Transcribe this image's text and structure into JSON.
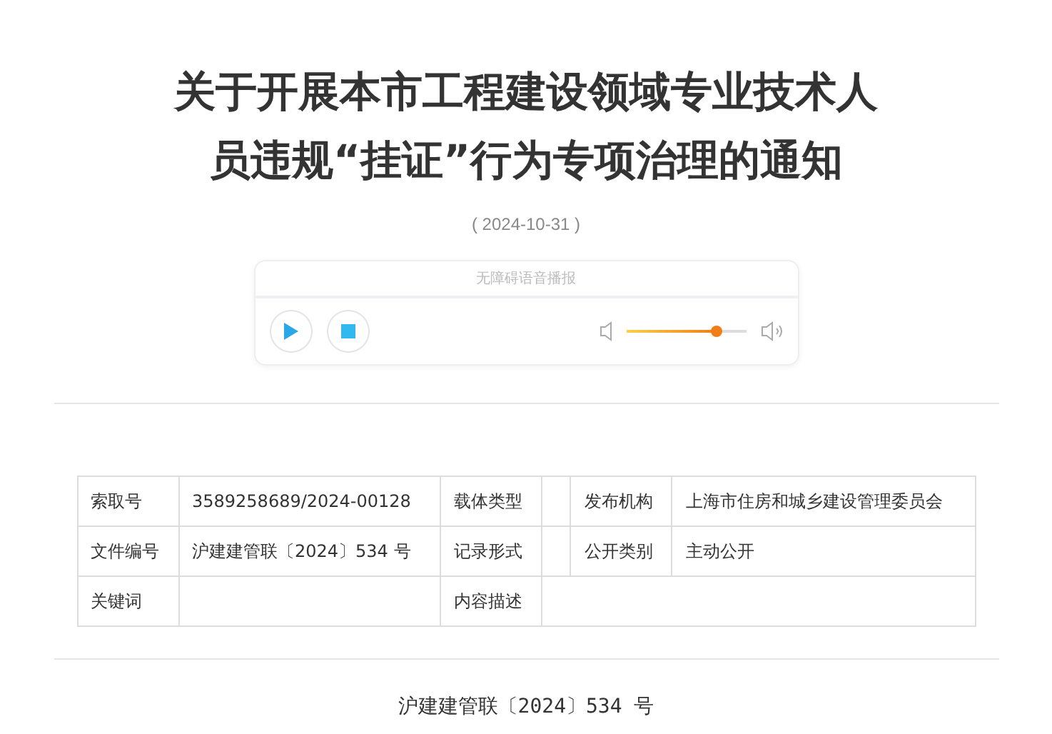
{
  "title_lines": [
    "关于开展本市工程建设领域专业技术人",
    "员违规“挂证”行为专项治理的通知"
  ],
  "date": "( 2024-10-31 )",
  "player": {
    "label": "无障碍语音播报",
    "volume": {
      "level": 0.76
    }
  },
  "meta_rows": [
    [
      {
        "label": "索取号",
        "value": "3589258689/2024-00128"
      },
      {
        "label": "载体类型"
      },
      {
        "label": "发布机构",
        "value": "上海市住房和城乡建设管理委员会"
      }
    ],
    [
      {
        "label": "文件编号",
        "value": "沪建建管联〔2024〕534 号"
      },
      {
        "label": "记录形式"
      },
      {
        "label": "公开类别",
        "value": "主动公开"
      }
    ],
    [
      {
        "label": "关键词"
      },
      {
        "label": "内容描述"
      }
    ]
  ],
  "doc_number": "沪建建管联〔2024〕534 号"
}
